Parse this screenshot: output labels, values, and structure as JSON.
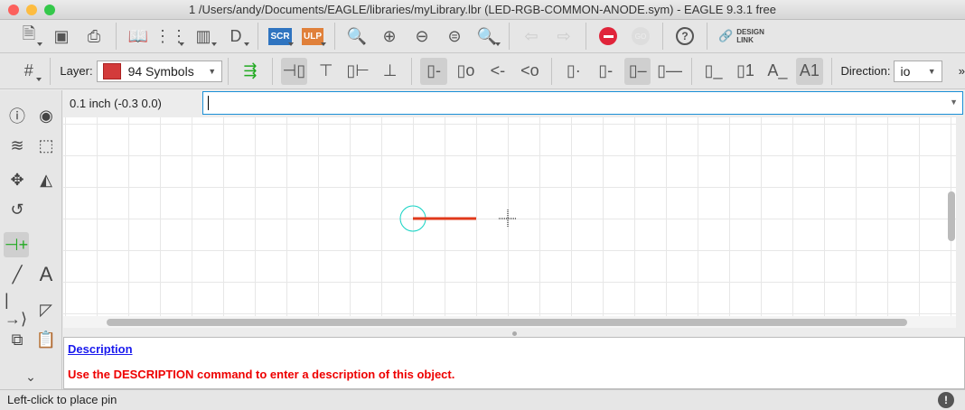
{
  "window": {
    "title": "1 /Users/andy/Documents/EAGLE/libraries/myLibrary.lbr (LED-RGB-COMMON-ANODE.sym) - EAGLE 9.3.1 free"
  },
  "toolbar": {
    "scr_label": "SCR",
    "ulp_label": "ULP",
    "go_label": "GO",
    "design_link_label": "DESIGN LINK",
    "help_label": "?"
  },
  "param_bar": {
    "layer_label": "Layer:",
    "layer_value": "94 Symbols",
    "layer_color": "#d33b3b",
    "direction_label": "Direction:",
    "direction_value": "io",
    "more_label": "»"
  },
  "coord_bar": {
    "grid_readout": "0.1 inch (-0.3 0.0)",
    "command_value": ""
  },
  "description": {
    "link": "Description",
    "message": "Use the DESCRIPTION command to enter a description of this object."
  },
  "status": {
    "text": "Left-click to place pin",
    "alert": "!"
  },
  "colors": {
    "pin": "#e0391b",
    "pin_circle": "#14d3c4",
    "accent": "#1a8fd6"
  }
}
